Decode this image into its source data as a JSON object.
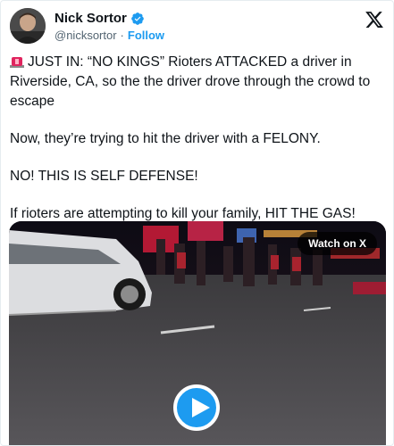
{
  "author": {
    "name": "Nick Sortor",
    "handle": "@nicksortor",
    "separator": "·",
    "follow_label": "Follow",
    "verified_color": "#1d9bf0",
    "avatar_icon": "avatar"
  },
  "post": {
    "paragraphs": [
      "JUST IN: “NO KINGS” Rioters  ATTACKED a driver in Riverside, CA, so the the driver drove through the crowd to escape",
      "Now, they’re trying to hit the driver with a FELONY.",
      "NO! THIS IS SELF DEFENSE!",
      "If rioters are attempting to kill your family, HIT THE GAS!"
    ],
    "lead_icon": "siren-icon"
  },
  "media": {
    "watch_label": "Watch on X",
    "play_icon": "play-icon"
  },
  "colors": {
    "accent": "#1d9bf0",
    "text": "#0f1419",
    "muted": "#536471"
  }
}
